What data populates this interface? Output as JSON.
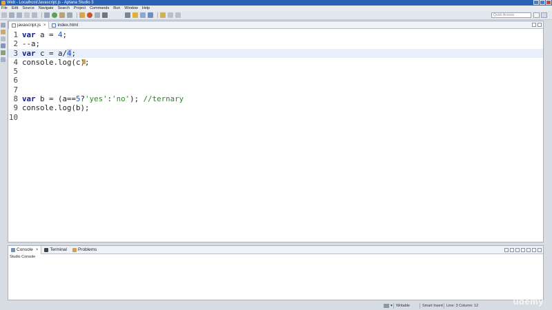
{
  "window": {
    "title": "Web - Localhost/Javascript.js - Aptana Studio 3"
  },
  "menu": [
    "File",
    "Edit",
    "Source",
    "Navigate",
    "Search",
    "Project",
    "Commands",
    "Run",
    "Window",
    "Help"
  ],
  "toolbar": {
    "quick_access_placeholder": "Quick Access"
  },
  "editor": {
    "tabs": [
      {
        "label": "javascript.js",
        "active": true
      },
      {
        "label": "index.html",
        "active": false
      }
    ],
    "lines": [
      {
        "n": "1"
      },
      {
        "n": "2"
      },
      {
        "n": "3"
      },
      {
        "n": "4"
      },
      {
        "n": "5"
      },
      {
        "n": "6"
      },
      {
        "n": "7"
      },
      {
        "n": "8"
      },
      {
        "n": "9"
      },
      {
        "n": "10"
      }
    ],
    "code": {
      "l1": {
        "kw": "var",
        "rest": " a = ",
        "num": "4",
        "end": ";"
      },
      "l2": {
        "text": "--a;"
      },
      "l3": {
        "kw": "var",
        "rest": " c = a/",
        "num": "4",
        "end": ";"
      },
      "l4": {
        "text": "console.log(c);"
      },
      "l8": {
        "kw": "var",
        "rest": " b = (a==",
        "num": "5",
        "q": "?",
        "s1": "'yes'",
        "colon": ":",
        "s2": "'no'",
        "end": "); ",
        "cmt": "//ternary"
      },
      "l9": {
        "text": "console.log(b);"
      }
    }
  },
  "console": {
    "tabs": [
      {
        "label": "Console",
        "close": "×"
      },
      {
        "label": "Terminal"
      },
      {
        "label": "Problems"
      }
    ],
    "title": "Studio Console"
  },
  "status": {
    "writable": "Writable",
    "insert_mode": "Smart Insert",
    "position": "Line: 3 Column: 12"
  },
  "watermark": "udemy",
  "colors": {
    "titlebar": "#2b61b5",
    "keyword": "#0f1a8a",
    "number": "#1a55c7",
    "string": "#2a8a1f",
    "comment": "#2f7d2f",
    "current_line": "#e8f0fc"
  }
}
